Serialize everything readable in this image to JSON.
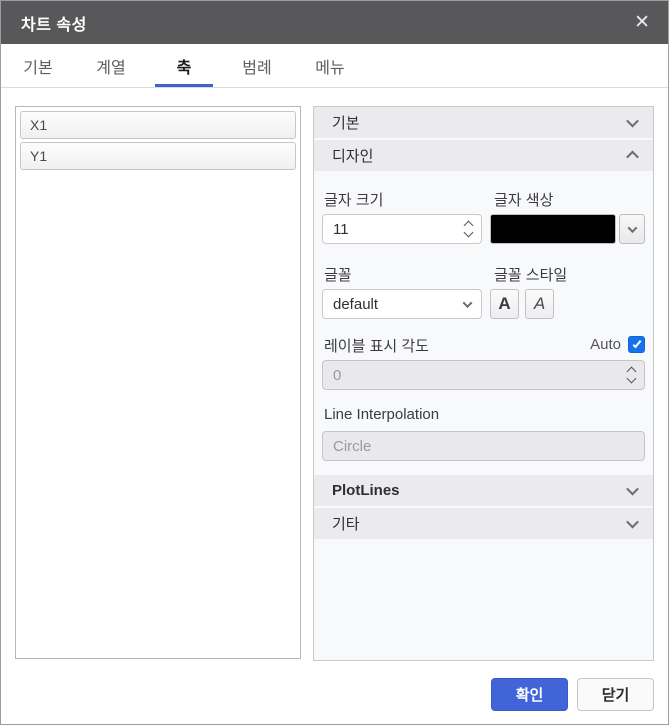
{
  "dialog": {
    "title": "차트 속성",
    "close_glyph": "✕"
  },
  "tabs": [
    {
      "label": "기본",
      "active": false
    },
    {
      "label": "계열",
      "active": false
    },
    {
      "label": "축",
      "active": true
    },
    {
      "label": "범례",
      "active": false
    },
    {
      "label": "메뉴",
      "active": false
    }
  ],
  "axis_list": [
    "X1",
    "Y1"
  ],
  "sections": {
    "basic": {
      "label": "기본",
      "expanded": false
    },
    "design": {
      "label": "디자인",
      "expanded": true
    },
    "plotlines": {
      "label": "PlotLines",
      "expanded": false
    },
    "etc": {
      "label": "기타",
      "expanded": false
    }
  },
  "design": {
    "font_size_label": "글자 크기",
    "font_size_value": "11",
    "font_color_label": "글자 색상",
    "font_color_value": "#000000",
    "font_label": "글꼴",
    "font_value": "default",
    "font_style_label": "글꼴 스타일",
    "bold_label": "A",
    "italic_label": "A",
    "angle_label": "레이블 표시 각도",
    "auto_label": "Auto",
    "auto_checked": true,
    "angle_value": "0",
    "angle_disabled": true,
    "interpolation_label": "Line Interpolation",
    "interpolation_value": "Circle",
    "interpolation_disabled": true
  },
  "footer": {
    "ok_label": "확인",
    "close_label": "닫기"
  },
  "colors": {
    "titlebar": "#58585a",
    "accent_blue": "#3c63d6",
    "primary_button": "#4164d9",
    "checkbox_blue": "#1672ec",
    "font_color_swatch": "#000000"
  }
}
